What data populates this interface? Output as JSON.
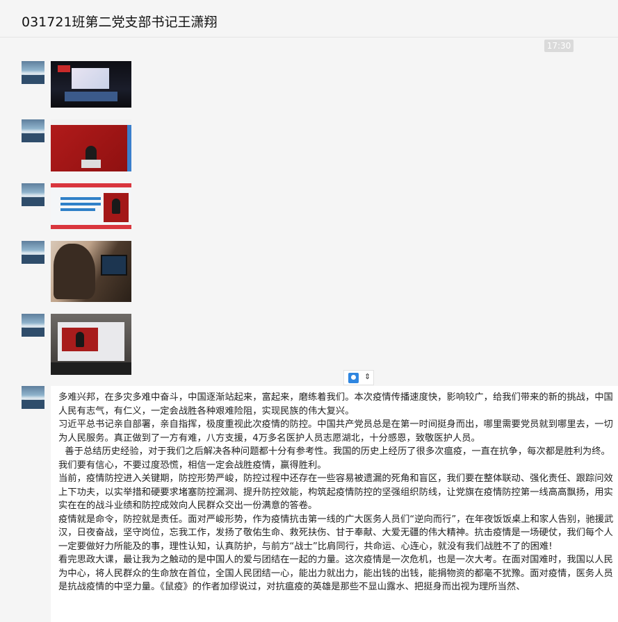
{
  "header": {
    "title": "031721班第二党支部书记王潇翔"
  },
  "time_badge": "17:30",
  "messages": [
    {
      "type": "image",
      "icon": "studio-photo"
    },
    {
      "type": "image",
      "icon": "stage-photo"
    },
    {
      "type": "image",
      "icon": "slide-photo"
    },
    {
      "type": "image",
      "icon": "person-laptop-photo"
    },
    {
      "type": "image",
      "icon": "laptop-screen-photo"
    }
  ],
  "text_message": {
    "paragraphs": [
      "多难兴邦，在多灾多难中奋斗，中国逐渐站起来，富起来，磨练着我们。本次疫情传播速度快，影响较广，给我们带来的新的挑战，中国人民有志气，有仁义，一定会战胜各种艰难险阻，实现民族的伟大复兴。",
      "习近平总书记亲自部署，亲自指挥，极度重视此次疫情的防控。中国共产党员总是在第一时间挺身而出，哪里需要党员就到哪里去，一切为人民服务。真正做到了一方有难，八方支援，4万多名医护人员志愿湖北，十分感恩，致敬医护人员。",
      "善于总结历史经验，对于我们之后解决各种问题都十分有参考性。我国的历史上经历了很多次瘟疫，一直在抗争，每次都是胜利为终。我们要有信心，不要过度恐慌，相信一定会战胜疫情，赢得胜利。",
      "当前，疫情防控进入关键期，防控形势严峻，防控过程中还存在一些容易被遗漏的死角和盲区，我们要在整体联动、强化责任、跟踪问效上下功夫，以实举措和硬要求堵塞防控漏洞、提升防控效能，构筑起疫情防控的坚强组织防线，让党旗在疫情防控第一线高高飘扬，用实实在在的战斗业绩和防控成效向人民群众交出一份满意的答卷。",
      "疫情就是命令，防控就是责任。面对严峻形势，作为疫情抗击第一线的广大医务人员们“逆向而行”，在年夜饭饭桌上和家人告别，驰援武汉，日夜奋战，坚守岗位，忘我工作，发扬了敬佑生命、救死扶伤、甘于奉献、大爱无疆的伟大精神。抗击疫情是一场硬仗，我们每个人一定要做好力所能及的事，理性认知，认真防护，与前方“战士”比肩同行，共命运、心连心，就没有我们战胜不了的困难!",
      "看完思政大课，最让我为之触动的是中国人的爱与团结在一起的力量。这次疫情是一次危机，也是一次大考。在面对国难时，我国以人民为中心，将人民群众的生命放在首位，全国人民团结一心，能出力就出力，能出钱的出钱，能捐物资的都毫不犹豫。面对疫情，医务人员是抗战疫情的中坚力量。《鼠疫》的作者加缪说过，对抗瘟疫的英雄是那些不显山露水、把挺身而出视为理所当然、"
    ]
  }
}
